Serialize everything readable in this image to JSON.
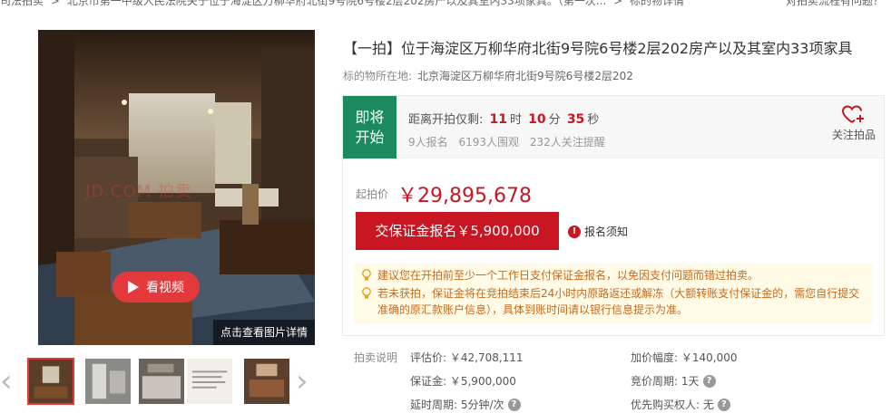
{
  "breadcrumb": {
    "items": [
      "司法拍卖",
      "北京市第一中级人民法院关于位于海淀区万柳华府北街9号院6号楼2层202房产以及其室内33项家具。（第一次...",
      "标的物详情"
    ],
    "separator": ">",
    "help_link": "对拍卖流程有问题？"
  },
  "gallery": {
    "video_button": "看视频",
    "detail_tag": "点击查看图片详情",
    "watermark": "JD.COM 拍卖",
    "thumbnails": [
      "living-room",
      "bathroom",
      "kitchen",
      "document",
      "bedroom"
    ],
    "active_index": 0
  },
  "item": {
    "title": "【一拍】位于海淀区万柳华府北街9号院6号楼2层202房产以及其室内33项家具",
    "location_label": "标的物所在地:",
    "location_value": "北京海淀区万柳华府北街9号院6号楼2层202"
  },
  "countdown": {
    "status": "即将开始",
    "label": "距离开拍仅剩:",
    "hours": "11",
    "hours_unit": "时",
    "minutes": "10",
    "minutes_unit": "分",
    "seconds": "35",
    "seconds_unit": "秒",
    "signups": "9人报名",
    "views": "6193人围观",
    "reminders": "232人关注提醒",
    "follow_label": "关注拍品"
  },
  "pricing": {
    "start_label": "起拍价",
    "start_value": "￥29,895,678",
    "deposit_button": "交保证金报名￥5,900,000",
    "notice_link": "报名须知"
  },
  "tips": [
    "建议您在开拍前至少一个工作日支付保证金报名，以免因支付问题而错过拍卖。",
    "若未获拍，保证金将在竞拍结束后24小时内原路返还或解冻（大额转账支付保证金的，需您自行提交准确的原汇款账户信息），具体到账时间请以银行信息提示为准。"
  ],
  "auction_info": {
    "section_label": "拍卖说明",
    "appraisal": "评估价: ￥42,708,111",
    "increment": "加价幅度: ￥140,000",
    "deposit": "保证金: ￥5,900,000",
    "bid_period": "竞价周期: 1天",
    "extension": "延时周期: 5分钟/次",
    "priority_buyer": "优先购买权人: 无"
  },
  "colors": {
    "accent_red": "#c81623",
    "status_green": "#1b8a5e",
    "tip_text": "#c76a1e",
    "tip_bg": "#fffbe6"
  }
}
